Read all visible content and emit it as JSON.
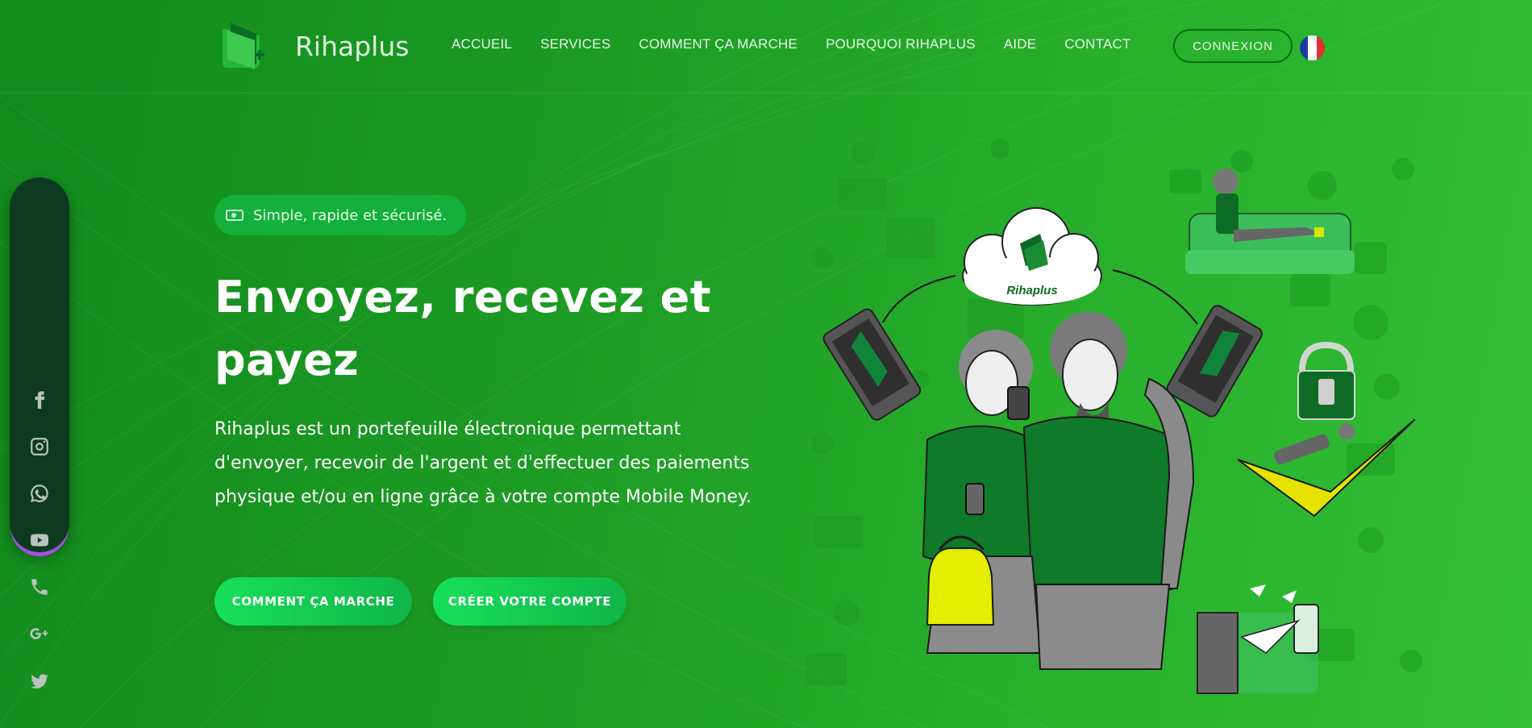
{
  "brand": {
    "name": "Rihaplus",
    "cloud_label": "Rihaplus"
  },
  "nav": {
    "items": [
      {
        "label": "ACCUEIL"
      },
      {
        "label": "SERVICES"
      },
      {
        "label": "COMMENT ÇA MARCHE"
      },
      {
        "label": "POURQUOI RIHAPLUS"
      },
      {
        "label": "AIDE"
      },
      {
        "label": "CONTACT"
      }
    ],
    "login_label": "CONNEXION",
    "language": "fr"
  },
  "social": {
    "icons": [
      "facebook-icon",
      "instagram-icon",
      "whatsapp-icon",
      "youtube-icon",
      "phone-icon",
      "google-plus-icon",
      "twitter-icon"
    ]
  },
  "hero": {
    "badge": "Simple, rapide et sécurisé.",
    "title": "Envoyez, recevez et payez",
    "description": "Rihaplus est un portefeuille électronique permettant d'envoyer, recevoir de l'argent et d'effectuer des paiements physique et/ou en ligne grâce à votre compte Mobile Money.",
    "button_how": "COMMENT ÇA MARCHE",
    "button_signup": "CRÉER VOTRE COMPTE"
  },
  "colors": {
    "accent": "#17e05a",
    "sidebar_bg": "#0f3a22",
    "sidebar_glow": "#9d52e0",
    "flag": [
      "#1a3ea8",
      "#ffffff",
      "#e03131"
    ]
  }
}
